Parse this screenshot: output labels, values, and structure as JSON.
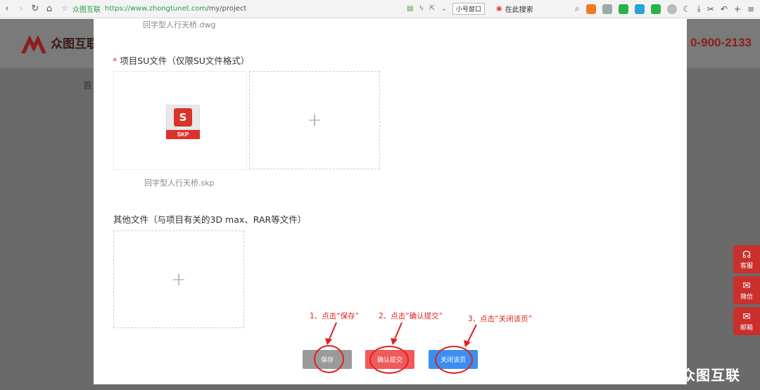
{
  "browser": {
    "site_name": "众图互联",
    "url_host": "https://www.zhongtunet.com",
    "url_path": "/my/project",
    "small_window": "小号窗口",
    "search_here": "在此搜索"
  },
  "background": {
    "logo_text": "众图互联",
    "phone": "0-900-2133",
    "nav_partial": "首",
    "side_buttons": [
      {
        "label": "客服",
        "icon": "headset-icon"
      },
      {
        "label": "微信",
        "icon": "wechat-icon"
      },
      {
        "label": "邮箱",
        "icon": "mail-icon"
      }
    ],
    "watermark": "搜狐号@众图互联"
  },
  "modal": {
    "prev_file_caption": "回字型人行天桥.dwg",
    "su_section": {
      "required_mark": "*",
      "title": "项目SU文件（仅限SU文件格式）",
      "file_badge": "SKP",
      "file_caption": "回字型人行天桥.skp",
      "add_symbol": "+"
    },
    "other_section": {
      "title": "其他文件（与项目有关的3D max、RAR等文件）",
      "add_symbol": "+"
    },
    "buttons": {
      "save": "保存",
      "submit": "确认提交",
      "close": "关闭该页"
    },
    "annotations": {
      "step1": "1、点击“保存”",
      "step2": "2、点击“确认提交”",
      "step3": "3、点击“关闭该页”"
    }
  },
  "colors": {
    "accent_red": "#e02020",
    "save_gray": "#9a9a9a",
    "submit_red": "#f05a5a",
    "close_blue": "#3b8ff2"
  }
}
